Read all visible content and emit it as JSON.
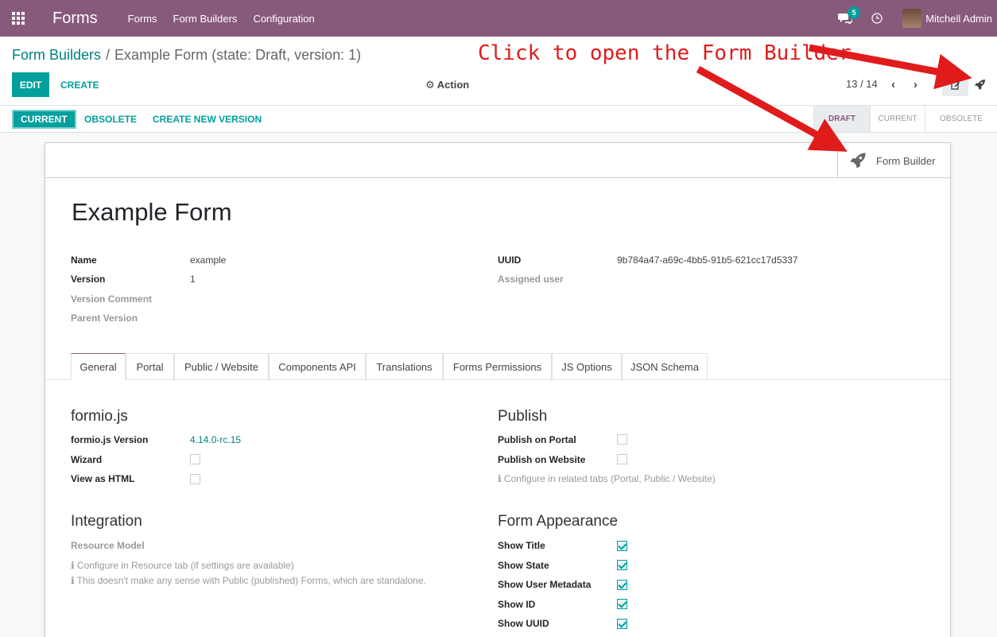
{
  "navbar": {
    "brand": "Forms",
    "menu": [
      "Forms",
      "Form Builders",
      "Configuration"
    ],
    "chat_badge": "5",
    "user_name": "Mitchell Admin"
  },
  "control_panel": {
    "breadcrumb_parent": "Form Builders",
    "breadcrumb_separator": "/",
    "breadcrumb_current": "Example Form (state: Draft, version: 1)",
    "edit_label": "EDIT",
    "create_label": "CREATE",
    "action_label": "Action",
    "pager": "13 / 14"
  },
  "statusbar": {
    "buttons": [
      "CURRENT",
      "OBSOLETE",
      "CREATE NEW VERSION"
    ],
    "states": [
      "DRAFT",
      "CURRENT",
      "OBSOLETE"
    ],
    "active_state": "DRAFT"
  },
  "annotation": {
    "text": "Click to open the Form Builder",
    "color": "#e01b1b"
  },
  "sheet": {
    "smart_button": "Form Builder",
    "title": "Example Form",
    "fields_left": [
      {
        "label": "Name",
        "value": "example"
      },
      {
        "label": "Version",
        "value": "1"
      },
      {
        "label": "Version Comment",
        "value": ""
      },
      {
        "label": "Parent Version",
        "value": ""
      }
    ],
    "fields_right": [
      {
        "label": "UUID",
        "value": "9b784a47-a69c-4bb5-91b5-621cc17d5337"
      },
      {
        "label": "Assigned user",
        "value": ""
      }
    ],
    "tabs": [
      "General",
      "Portal",
      "Public / Website",
      "Components API",
      "Translations",
      "Forms Permissions",
      "JS Options",
      "JSON Schema"
    ],
    "active_tab": "General",
    "formio": {
      "title": "formio.js",
      "version_label": "formio.js Version",
      "version_value": "4.14.0-rc.15",
      "wizard_label": "Wizard",
      "wizard_checked": false,
      "html_label": "View as HTML",
      "html_checked": false
    },
    "publish": {
      "title": "Publish",
      "portal_label": "Publish on Portal",
      "portal_checked": false,
      "website_label": "Publish on Website",
      "website_checked": false,
      "hint": "Configure in related tabs (Portal, Public / Website)"
    },
    "integration": {
      "title": "Integration",
      "resource_label": "Resource Model",
      "hint1": "Configure in Resource tab (if settings are available)",
      "hint2": "This doesn't make any sense with Public (published) Forms, which are standalone."
    },
    "appearance": {
      "title": "Form Appearance",
      "items": [
        {
          "label": "Show Title",
          "checked": true
        },
        {
          "label": "Show State",
          "checked": true
        },
        {
          "label": "Show User Metadata",
          "checked": true
        },
        {
          "label": "Show ID",
          "checked": true
        },
        {
          "label": "Show UUID",
          "checked": true
        }
      ]
    }
  },
  "colors": {
    "navbar": "#875a7b",
    "primary": "#00a09d",
    "link": "#00807c"
  }
}
